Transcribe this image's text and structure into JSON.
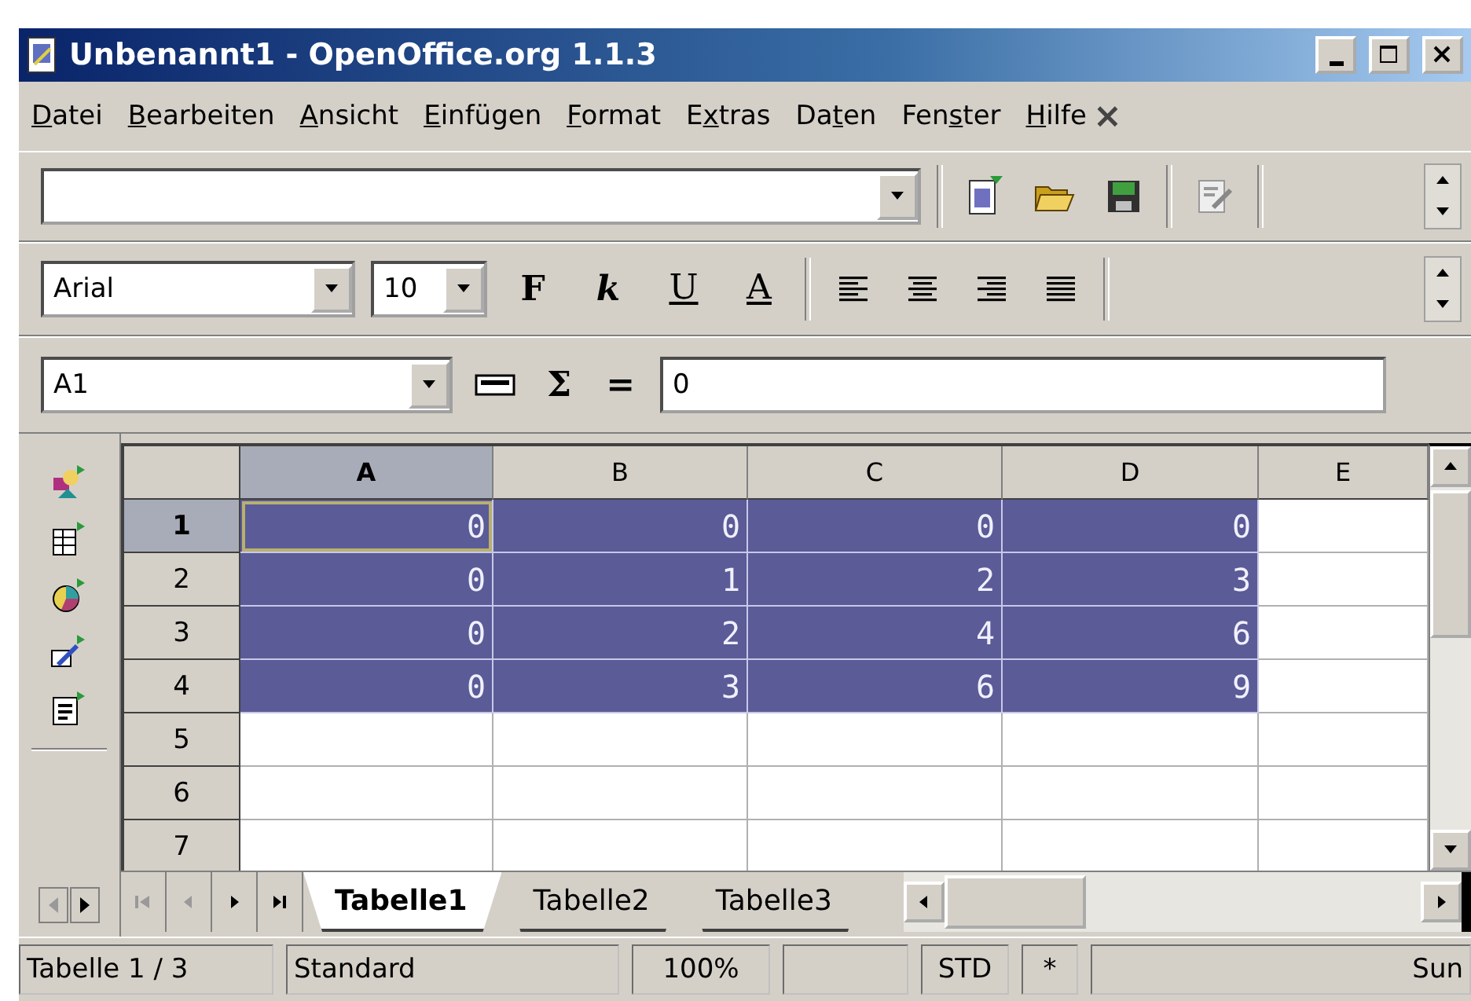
{
  "window": {
    "title": "Unbenannt1 - OpenOffice.org 1.1.3"
  },
  "menu": [
    {
      "segments": [
        {
          "text": "D",
          "underlined": true
        },
        {
          "text": "atei",
          "underlined": false
        }
      ]
    },
    {
      "segments": [
        {
          "text": "B",
          "underlined": true
        },
        {
          "text": "earbeiten",
          "underlined": false
        }
      ]
    },
    {
      "segments": [
        {
          "text": "A",
          "underlined": true
        },
        {
          "text": "nsicht",
          "underlined": false
        }
      ]
    },
    {
      "segments": [
        {
          "text": "E",
          "underlined": true
        },
        {
          "text": "infügen",
          "underlined": false
        }
      ]
    },
    {
      "segments": [
        {
          "text": "F",
          "underlined": true
        },
        {
          "text": "ormat",
          "underlined": false
        }
      ]
    },
    {
      "segments": [
        {
          "text": "E",
          "underlined": false
        },
        {
          "text": "x",
          "underlined": true
        },
        {
          "text": "tras",
          "underlined": false
        }
      ]
    },
    {
      "segments": [
        {
          "text": "Da",
          "underlined": false
        },
        {
          "text": "t",
          "underlined": true
        },
        {
          "text": "en",
          "underlined": false
        }
      ]
    },
    {
      "segments": [
        {
          "text": "Fen",
          "underlined": false
        },
        {
          "text": "s",
          "underlined": true
        },
        {
          "text": "ter",
          "underlined": false
        }
      ]
    },
    {
      "segments": [
        {
          "text": "H",
          "underlined": true
        },
        {
          "text": "ilfe",
          "underlined": false
        }
      ]
    }
  ],
  "menu_close": "×",
  "formatting": {
    "font_name": "Arial",
    "font_size": "10",
    "styles": [
      {
        "kind": "bold",
        "label": "F"
      },
      {
        "kind": "italic",
        "label": "k"
      },
      {
        "kind": "underline",
        "label": "U"
      },
      {
        "kind": "color",
        "label": "A"
      }
    ]
  },
  "formula_bar": {
    "cell_ref": "A1",
    "sum_symbol": "Σ",
    "equals_symbol": "=",
    "content": "0"
  },
  "sheet": {
    "columns": [
      {
        "label": "A",
        "selected": true
      },
      {
        "label": "B",
        "selected": false
      },
      {
        "label": "C",
        "selected": false
      },
      {
        "label": "D",
        "selected": false
      },
      {
        "label": "E",
        "selected": false
      }
    ],
    "rows": [
      {
        "label": "1",
        "selected": true,
        "cells": [
          {
            "value": "0",
            "selected": true,
            "cursor": true
          },
          {
            "value": "0",
            "selected": true
          },
          {
            "value": "0",
            "selected": true
          },
          {
            "value": "0",
            "selected": true
          },
          {
            "selected": false
          }
        ]
      },
      {
        "label": "2",
        "selected": false,
        "cells": [
          {
            "value": "0",
            "selected": true
          },
          {
            "value": "1",
            "selected": true
          },
          {
            "value": "2",
            "selected": true
          },
          {
            "value": "3",
            "selected": true
          },
          {
            "selected": false
          }
        ]
      },
      {
        "label": "3",
        "selected": false,
        "cells": [
          {
            "value": "0",
            "selected": true
          },
          {
            "value": "2",
            "selected": true
          },
          {
            "value": "4",
            "selected": true
          },
          {
            "value": "6",
            "selected": true
          },
          {
            "selected": false
          }
        ]
      },
      {
        "label": "4",
        "selected": false,
        "cells": [
          {
            "value": "0",
            "selected": true
          },
          {
            "value": "3",
            "selected": true
          },
          {
            "value": "6",
            "selected": true
          },
          {
            "value": "9",
            "selected": true
          },
          {
            "selected": false
          }
        ]
      },
      {
        "label": "5",
        "selected": false,
        "cells": [
          {
            "selected": false
          },
          {
            "selected": false
          },
          {
            "selected": false
          },
          {
            "selected": false
          },
          {
            "selected": false
          }
        ]
      },
      {
        "label": "6",
        "selected": false,
        "cells": [
          {
            "selected": false
          },
          {
            "selected": false
          },
          {
            "selected": false
          },
          {
            "selected": false
          },
          {
            "selected": false
          }
        ]
      },
      {
        "label": "7",
        "selected": false,
        "cells": [
          {
            "selected": false
          },
          {
            "selected": false
          },
          {
            "selected": false
          },
          {
            "selected": false
          },
          {
            "selected": false
          }
        ]
      }
    ]
  },
  "sheet_tabs": [
    {
      "label": "Tabelle1",
      "selected": true
    },
    {
      "label": "Tabelle2",
      "selected": false
    },
    {
      "label": "Tabelle3",
      "selected": false
    }
  ],
  "status_bar": [
    {
      "kind": "text",
      "text": "Tabelle 1 / 3"
    },
    {
      "kind": "text",
      "text": "Standard"
    },
    {
      "kind": "text",
      "text": "100%"
    },
    {
      "kind": "blank"
    },
    {
      "kind": "text",
      "text": "STD"
    },
    {
      "kind": "text",
      "text": "*"
    },
    {
      "kind": "text",
      "text": "Sun"
    }
  ]
}
